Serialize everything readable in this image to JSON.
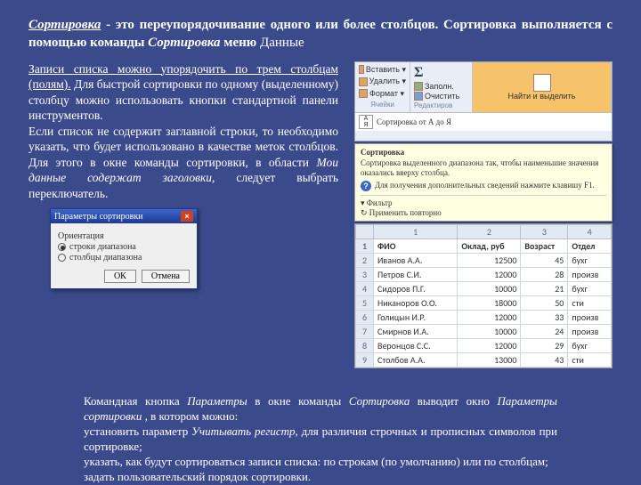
{
  "title": {
    "p1a": "Сортировка",
    "p1b": " - это переупорядочивание одного или более столбцов. Сортировка выполняется с помощью команды ",
    "p1c": "Сортировка",
    "p1d": " меню ",
    "p1e": "Данные"
  },
  "body": {
    "p1a": "Записи списка можно упорядочить по трем столбцам (полям).",
    "p1b": " Для быстрой сортировки по одному (выделенному) столбцу можно использовать кнопки стандартной панели инструментов.",
    "p2a": "Если список не содержит заглавной строки, то необходимо указать, что будет использовано в качестве меток столбцов. Для этого в окне команды сортировки, в области ",
    "p2b": "Мои данные содержат заголовки",
    "p2c": ", следует выбрать переключатель."
  },
  "ribbon": {
    "paste": "Вставить",
    "cells_items": [
      "Вставить ▾",
      "Удалить ▾",
      "Формат ▾"
    ],
    "cells_group": "Ячейки",
    "sum": "Σ",
    "fill": "Заполн.",
    "clear": "Очистить",
    "edit_group": "Редактиров",
    "find": "Найти и выделить",
    "sort_button": "Сортировка от А до Я"
  },
  "tooltip": {
    "t": "Сортировка",
    "d": "Сортировка выделенного диапазона так, чтобы наименьшие значения оказались вверху столбца.",
    "help": "Для получения дополнительных сведений нажмите клавишу F1."
  },
  "menu": {
    "m1": "Фильтр",
    "m2": "Применить повторно"
  },
  "sheet": {
    "cols": [
      "",
      "1",
      "2",
      "3",
      "4"
    ],
    "headers": [
      "ФИО",
      "Оклад, руб",
      "Возраст",
      "Отдел"
    ],
    "rows": [
      [
        "Иванов А.А.",
        "12500",
        "45",
        "бухг"
      ],
      [
        "Петров С.И.",
        "12000",
        "28",
        "произв"
      ],
      [
        "Сидоров П.Г.",
        "10000",
        "21",
        "бухг"
      ],
      [
        "Никаноров О.О.",
        "18000",
        "50",
        "сти"
      ],
      [
        "Голицын И.Р.",
        "12000",
        "33",
        "произв"
      ],
      [
        "Смирнов И.А.",
        "10000",
        "24",
        "произв"
      ],
      [
        "Веронцов С.С.",
        "12000",
        "29",
        "бухг"
      ],
      [
        "Столбов А.А.",
        "13000",
        "43",
        "сти"
      ]
    ]
  },
  "dialog": {
    "title": "Параметры сортировки",
    "grp1": "Ориентация",
    "r1": "строки диапазона",
    "r2": "столбцы диапазона",
    "ok": "ОК",
    "cancel": "Отмена"
  },
  "footer": {
    "f1a": "Командная кнопка ",
    "f1b": "Параметры",
    "f1c": " в окне команды ",
    "f1d": "Сортировка",
    "f1e": " выводит окно ",
    "f1f": "Параметры сортировки ",
    "f1g": ", в котором можно:",
    "f2a": "установить параметр ",
    "f2b": "Учитывать регистр",
    "f2c": ", для различия строчных и прописных символов при сортировке;",
    "f3": "указать, как будут сортироваться записи списка: по строкам (по умолчанию) или по столбцам;",
    "f4": "задать пользовательский порядок сортировки."
  }
}
